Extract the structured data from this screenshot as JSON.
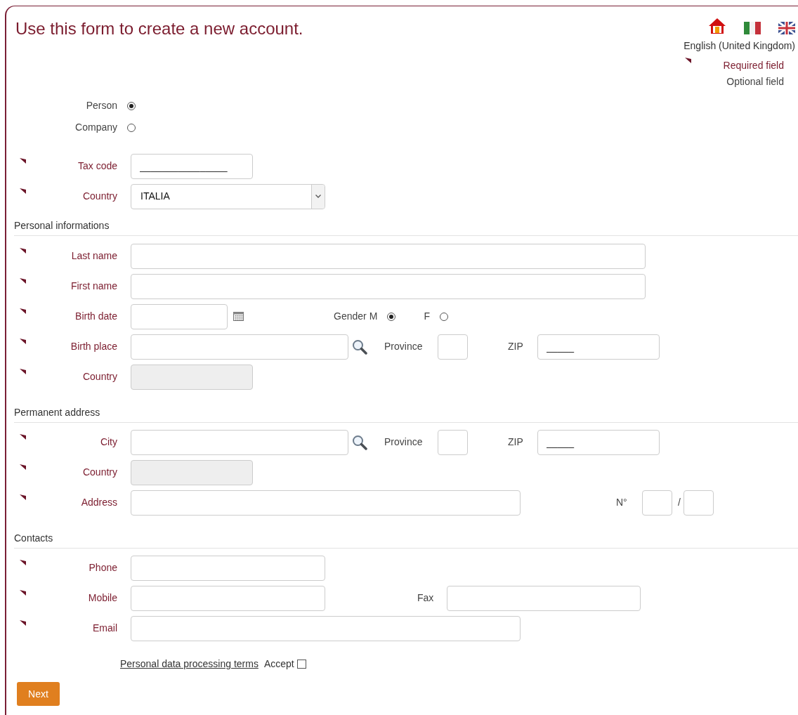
{
  "header": {
    "title": "Use this form to create a new account.",
    "language": "English (United Kingdom)",
    "legend": [
      {
        "label": "Required field",
        "required": true
      },
      {
        "label": "Optional field",
        "required": false
      }
    ]
  },
  "account_type": [
    {
      "label": "Person",
      "selected": true
    },
    {
      "label": "Company",
      "selected": false
    }
  ],
  "tax_code": {
    "label": "Tax code",
    "required": true,
    "value": "________________"
  },
  "country": {
    "label": "Country",
    "required": true,
    "value": "ITALIA"
  },
  "personal": {
    "title": "Personal informations",
    "last_name": {
      "label": "Last name",
      "required": true
    },
    "first_name": {
      "label": "First name",
      "required": true
    },
    "birth_date": {
      "label": "Birth date",
      "required": true
    },
    "gender": {
      "label": "Gender",
      "options": [
        {
          "label": "M",
          "selected": true
        },
        {
          "label": "F",
          "selected": false
        }
      ]
    },
    "birth_place": {
      "label": "Birth place",
      "required": true
    },
    "province": {
      "label": "Province",
      "required": false
    },
    "zip": {
      "label": "ZIP",
      "required": false,
      "value": "_____"
    },
    "country": {
      "label": "Country",
      "required": true,
      "disabled": true
    }
  },
  "address": {
    "title": "Permanent address",
    "city": {
      "label": "City",
      "required": true
    },
    "province": {
      "label": "Province",
      "required": false
    },
    "zip": {
      "label": "ZIP",
      "required": false,
      "value": "_____"
    },
    "country": {
      "label": "Country",
      "required": true,
      "disabled": true
    },
    "address": {
      "label": "Address",
      "required": true
    },
    "number": {
      "label": "N°",
      "required": false,
      "separator": "/"
    }
  },
  "contacts": {
    "title": "Contacts",
    "phone": {
      "label": "Phone",
      "required": true
    },
    "mobile": {
      "label": "Mobile",
      "required": true
    },
    "fax": {
      "label": "Fax",
      "required": false
    },
    "email": {
      "label": "Email",
      "required": true
    }
  },
  "terms": {
    "link": "Personal data processing terms",
    "accept": {
      "label": "Accept",
      "checked": false
    }
  },
  "next_button": "Next"
}
